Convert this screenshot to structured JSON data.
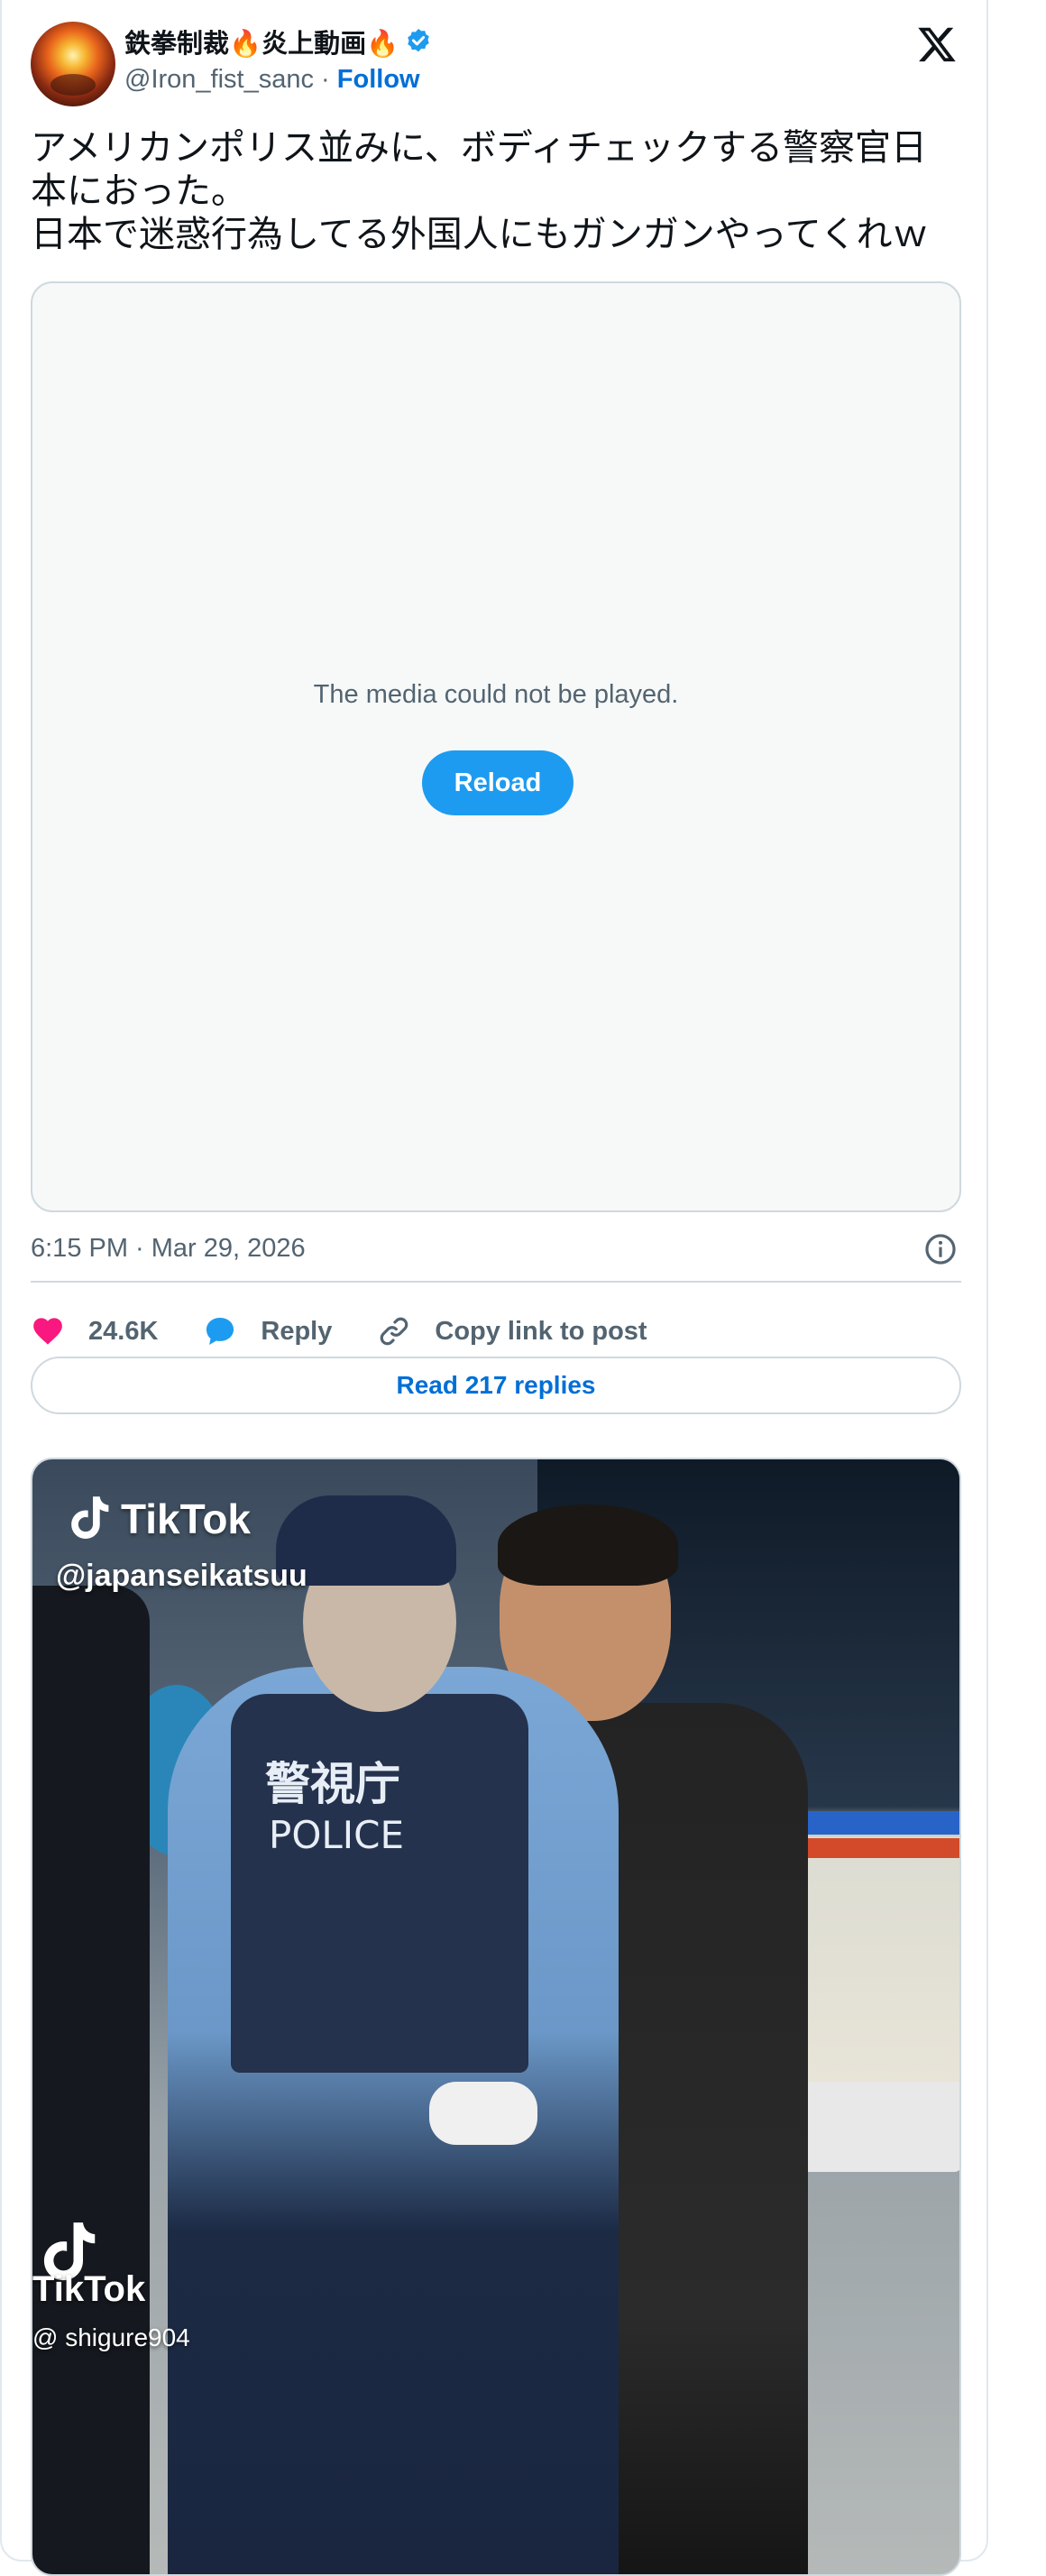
{
  "author": {
    "display_name": "鉄拳制裁🔥炎上動画🔥",
    "handle": "@Iron_fist_sanc",
    "separator": "·",
    "follow_label": "Follow",
    "verified_color": "#1d9bf0"
  },
  "icons": {
    "platform_logo": "x-logo-icon",
    "verified": "verified-badge-icon",
    "info": "info-icon",
    "like": "heart-icon",
    "reply": "speech-bubble-icon",
    "copy_link": "link-icon",
    "tiktok": "tiktok-logo-icon"
  },
  "tweet": {
    "text": "アメリカンポリス並みに、ボディチェックする警察官日\n本におった。\n日本で迷惑行為してる外国人にもガンガンやってくれｗ"
  },
  "media": {
    "error_message": "The media could not be played.",
    "reload_label": "Reload"
  },
  "meta": {
    "timestamp": "6:15 PM · Mar 29, 2026"
  },
  "actions": {
    "likes": "24.6K",
    "reply_label": "Reply",
    "copy_link_label": "Copy link to post",
    "read_replies_label": "Read 217 replies"
  },
  "video_preview": {
    "watermark_brand": "TikTok",
    "watermark_handle": "@japanseikatsuu",
    "watermark_brand_2": "TikTok",
    "watermark_handle_2": "@ shigure904",
    "vest_text_1": "警視庁",
    "vest_text_2": "POLICE"
  },
  "colors": {
    "accent": "#1d9bf0",
    "link": "#006fd6",
    "like": "#f91880",
    "muted": "#536471",
    "border": "#cfd9de"
  }
}
